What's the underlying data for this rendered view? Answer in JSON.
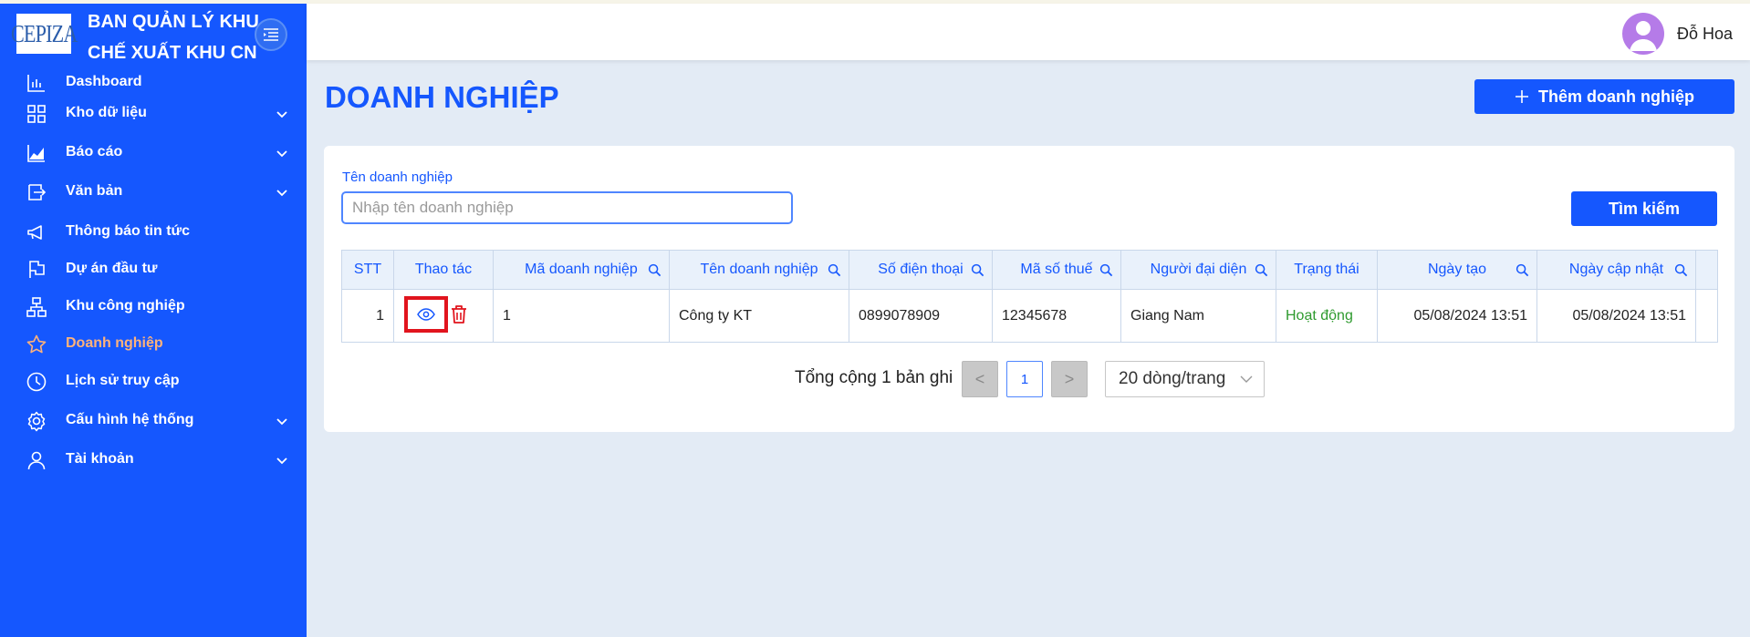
{
  "sidebar": {
    "brand_logo": "CEPIZA",
    "brand_line1": "BAN QUẢN LÝ KHU",
    "brand_line2": "CHẾ XUẤT KHU CN",
    "items": [
      {
        "label": "Dashboard",
        "icon": "bar-chart-icon"
      },
      {
        "label": "Kho dữ liệu",
        "icon": "grid-icon",
        "expandable": true
      },
      {
        "label": "Báo cáo",
        "icon": "area-chart-icon",
        "expandable": true
      },
      {
        "label": "Văn bản",
        "icon": "document-transfer-icon",
        "expandable": true
      },
      {
        "label": "Thông báo tin tức",
        "icon": "megaphone-icon"
      },
      {
        "label": "Dự án đầu tư",
        "icon": "flag-icon"
      },
      {
        "label": "Khu công nghiệp",
        "icon": "cluster-icon"
      },
      {
        "label": "Doanh nghiệp",
        "icon": "star-icon",
        "active": true
      },
      {
        "label": "Lịch sử truy cập",
        "icon": "clock-icon"
      },
      {
        "label": "Cấu hình hệ thống",
        "icon": "gear-icon",
        "expandable": true
      },
      {
        "label": "Tài khoản",
        "icon": "user-icon",
        "expandable": true
      }
    ]
  },
  "header": {
    "username": "Đỗ Hoa"
  },
  "page": {
    "title": "DOANH NGHIỆP",
    "add_button": "Thêm doanh nghiệp"
  },
  "search": {
    "label": "Tên doanh nghiệp",
    "placeholder": "Nhập tên doanh nghiệp",
    "value": "",
    "button": "Tìm kiếm"
  },
  "table": {
    "columns": [
      "STT",
      "Thao tác",
      "Mã doanh nghiệp",
      "Tên doanh nghiệp",
      "Số điện thoại",
      "Mã số thuế",
      "Người đại diện",
      "Trạng thái",
      "Ngày tạo",
      "Ngày cập nhật"
    ],
    "rows": [
      {
        "stt": "1",
        "ma": "1",
        "ten": "Công ty KT",
        "sdt": "0899078909",
        "mst": "12345678",
        "daidien": "Giang Nam",
        "trangthai": "Hoạt động",
        "ngaytao": "05/08/2024 13:51",
        "ngaycapnhat": "05/08/2024 13:51"
      }
    ]
  },
  "pagination": {
    "total": "Tổng cộng 1 bản ghi",
    "prev": "<",
    "current": "1",
    "next": ">",
    "page_size": "20 dòng/trang"
  },
  "colors": {
    "primary": "#1557fe",
    "active_nav": "#ffb27a",
    "status_active": "#2e9a2e",
    "danger": "#e1141d"
  }
}
